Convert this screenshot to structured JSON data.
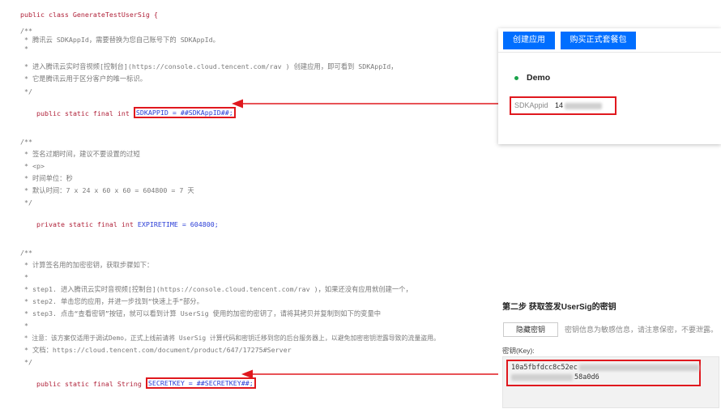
{
  "code": {
    "class_header": "public class GenerateTestUserSig {",
    "block1": {
      "c1": "/**",
      "c2": " * 腾讯云 SDKAppId，需要替换为您自己账号下的 SDKAppId。",
      "c3": " *",
      "c4": " * 进入腾讯云实时音视频[控制台](https://console.cloud.tencent.com/rav ) 创建应用，即可看到 SDKAppId，",
      "c5": " * 它是腾讯云用于区分客户的唯一标识。",
      "c6": " */",
      "decl_prefix": "public static final int ",
      "decl_highlight": "SDKAPPID = ##SDKAppID##;"
    },
    "block2": {
      "c1": "/**",
      "c2": " * 签名过期时间，建议不要设置的过短",
      "c3": " * <p>",
      "c4": " * 时间单位：秒",
      "c5": " * 默认时间：7 x 24 x 60 x 60 = 604800 = 7 天",
      "c6": " */",
      "decl_prefix": "private static final int ",
      "decl_value": "EXPIRETIME = 604800;"
    },
    "block3": {
      "c1": "/**",
      "c2": " * 计算签名用的加密密钥，获取步骤如下：",
      "c3": " *",
      "c4": " * step1. 进入腾讯云实时音视频[控制台](https://console.cloud.tencent.com/rav )，如果还没有应用就创建一个，",
      "c5": " * step2. 单击您的应用，并进一步找到“快速上手”部分。",
      "c6": " * step3. 点击“查看密钥”按钮，就可以看到计算 UserSig 使用的加密的密钥了，请将其拷贝并复制到如下的变量中",
      "c7": " *",
      "c8": " * 注意：该方案仅适用于调试Demo，正式上线前请将 UserSig 计算代码和密钥迁移到您的后台服务器上，以避免加密密钥泄露导致的流量盗用。",
      "c9": " * 文档：https://cloud.tencent.com/document/product/647/17275#Server",
      "c10": " */",
      "decl_prefix": "public static final String ",
      "decl_highlight": "SECRETKEY = ##SECRETKEY##;"
    }
  },
  "console_top": {
    "create_app_button": "创建应用",
    "buy_package_button": "购买正式套餐包",
    "app_name": "Demo",
    "sdkappid_label": "SDKAppid",
    "sdkappid_value_visible": "14"
  },
  "console_bottom": {
    "step_title": "第二步 获取签发UserSig的密钥",
    "hide_key_button": "隐藏密钥",
    "hint_text": "密钥信息为敏感信息，请注意保密，不要泄露。",
    "key_label": "密钥(Key):",
    "key_line1_visible": "10a5fbfdcc8c52ec",
    "key_line2_visible": "58a0d6"
  },
  "colors": {
    "highlight_red": "#e0181e",
    "button_blue": "#006eff",
    "keyword_red": "#b0223a",
    "identifier_blue": "#2a3dd6",
    "status_green": "#1aa34a"
  }
}
